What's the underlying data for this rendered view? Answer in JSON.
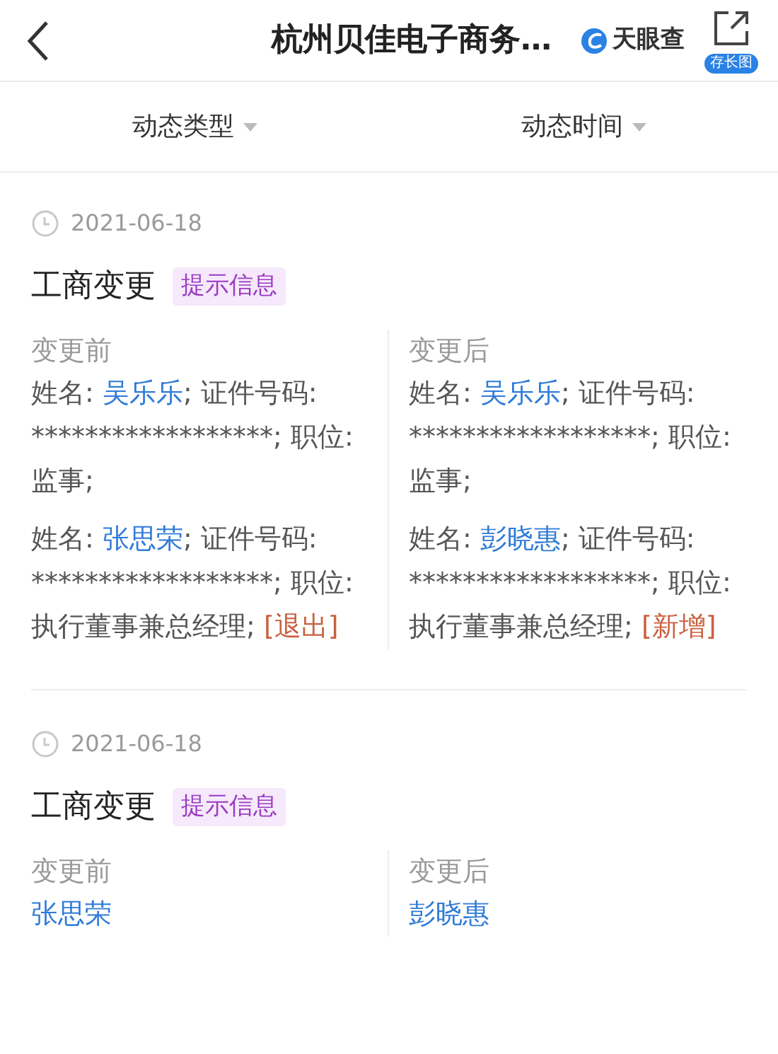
{
  "header": {
    "title": "杭州贝佳电子商务…",
    "brand": "天眼查",
    "save_badge": "存长图"
  },
  "filters": [
    {
      "label": "动态类型"
    },
    {
      "label": "动态时间"
    }
  ],
  "events": [
    {
      "date": "2021-06-18",
      "title": "工商变更",
      "tag": "提示信息",
      "columns": [
        {
          "heading": "变更前",
          "records": [
            {
              "parts": [
                {
                  "kind": "text",
                  "text": "姓名: "
                },
                {
                  "kind": "link",
                  "text": "吴乐乐"
                },
                {
                  "kind": "text",
                  "text": "; 证件号码: ******************; 职位: 监事;"
                }
              ]
            },
            {
              "parts": [
                {
                  "kind": "text",
                  "text": "姓名: "
                },
                {
                  "kind": "link",
                  "text": "张思荣"
                },
                {
                  "kind": "text",
                  "text": "; 证件号码: ******************; 职位: 执行董事兼总经理; "
                },
                {
                  "kind": "status",
                  "text": "[退出]"
                }
              ]
            }
          ]
        },
        {
          "heading": "变更后",
          "records": [
            {
              "parts": [
                {
                  "kind": "text",
                  "text": "姓名: "
                },
                {
                  "kind": "link",
                  "text": "吴乐乐"
                },
                {
                  "kind": "text",
                  "text": "; 证件号码: ******************; 职位: 监事;"
                }
              ]
            },
            {
              "parts": [
                {
                  "kind": "text",
                  "text": "姓名: "
                },
                {
                  "kind": "link",
                  "text": "彭晓惠"
                },
                {
                  "kind": "text",
                  "text": "; 证件号码: ******************; 职位: 执行董事兼总经理; "
                },
                {
                  "kind": "status",
                  "text": "[新增]"
                }
              ]
            }
          ]
        }
      ]
    },
    {
      "date": "2021-06-18",
      "title": "工商变更",
      "tag": "提示信息",
      "columns": [
        {
          "heading": "变更前",
          "records": [
            {
              "parts": [
                {
                  "kind": "link",
                  "text": "张思荣"
                }
              ]
            }
          ]
        },
        {
          "heading": "变更后",
          "records": [
            {
              "parts": [
                {
                  "kind": "link",
                  "text": "彭晓惠"
                }
              ]
            }
          ]
        }
      ]
    }
  ]
}
